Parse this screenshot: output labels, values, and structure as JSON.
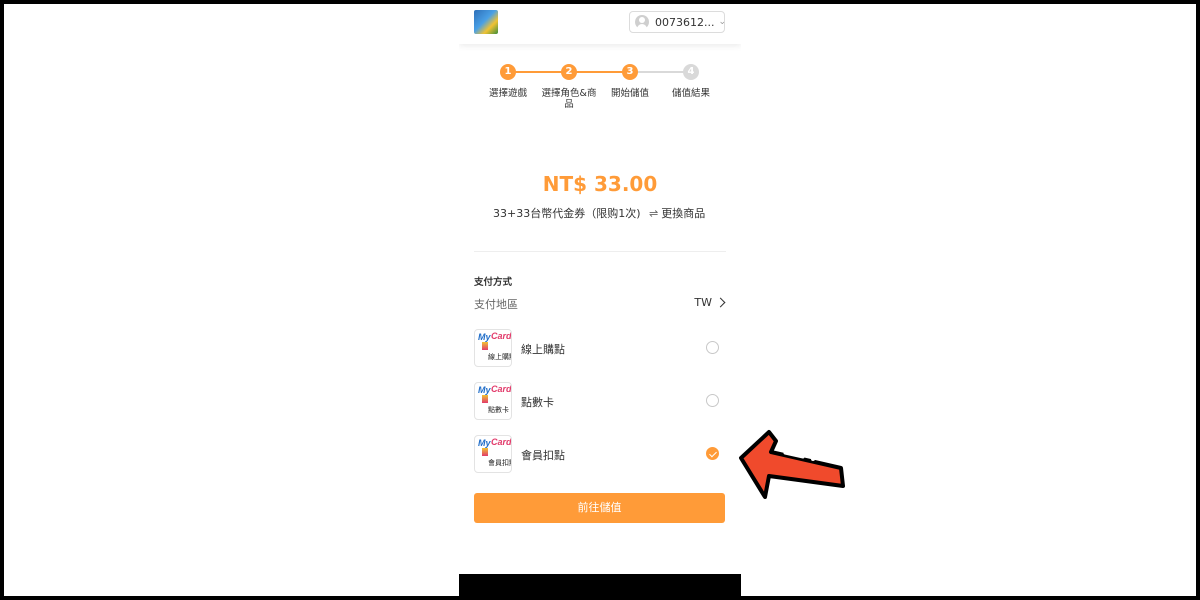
{
  "header": {
    "account_id": "0073612...",
    "account_chevron": "⌄",
    "game_logo_icon": "game-logo"
  },
  "steps": [
    {
      "number": "1",
      "label": "選擇遊戲",
      "state": "done"
    },
    {
      "number": "2",
      "label": "選擇角色&商品",
      "state": "done"
    },
    {
      "number": "3",
      "label": "開始儲值",
      "state": "active"
    },
    {
      "number": "4",
      "label": "儲值結果",
      "state": "pending"
    }
  ],
  "product": {
    "price": "NT$ 33.00",
    "name": "33+33台幣代金券（限购1次)",
    "change_icon": "⇌",
    "change_label": "更換商品"
  },
  "payment": {
    "section_title": "支付方式",
    "region_label": "支付地區",
    "region_value": "TW",
    "methods": [
      {
        "label": "線上購點",
        "logo_my": "My",
        "logo_card": "Card",
        "logo_sub": "線上購點",
        "selected": false
      },
      {
        "label": "點數卡",
        "logo_my": "My",
        "logo_card": "Card",
        "logo_sub": "點數卡",
        "selected": false
      },
      {
        "label": "會員扣點",
        "logo_my": "My",
        "logo_card": "Card",
        "logo_sub": "會員扣點",
        "selected": true
      }
    ],
    "submit_label": "前往儲值"
  },
  "colors": {
    "accent": "#ff9b38",
    "pending": "#d9d9d9",
    "annotation_arrow": "#f04a2c"
  },
  "annotation": {
    "icon": "red-arrow-icon",
    "points_to": "會員扣點"
  }
}
